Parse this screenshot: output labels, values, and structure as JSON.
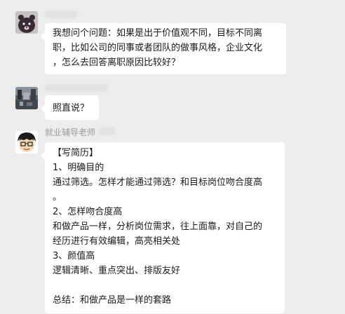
{
  "messages": [
    {
      "sender_name": "",
      "lines": [
        "我想问个问题：如果是出于价值观不同，目标不同离",
        "职，比如公司的同事或者团队的做事风格，企业文化",
        "，怎么去回答离职原因比较好？"
      ]
    },
    {
      "sender_name": "",
      "lines": [
        "照直说？"
      ]
    },
    {
      "sender_name": "就业辅导老师",
      "lines": [
        "【写简历】",
        "1、明确目的",
        "通过筛选。怎样才能通过筛选？和目标岗位吻合度高",
        "。",
        "2、怎样吻合度高",
        "和做产品一样，分析岗位需求，往上面靠，对自己的",
        "经历进行有效编辑，高亮相关处",
        "3、颜值高",
        "逻辑清晰、重点突出、排版友好",
        "",
        "总结：和做产品是一样的套路"
      ]
    }
  ],
  "colors": {
    "chat_background": "#ededed",
    "bubble_background": "#ffffff",
    "sender_name": "#9b9b9b"
  }
}
